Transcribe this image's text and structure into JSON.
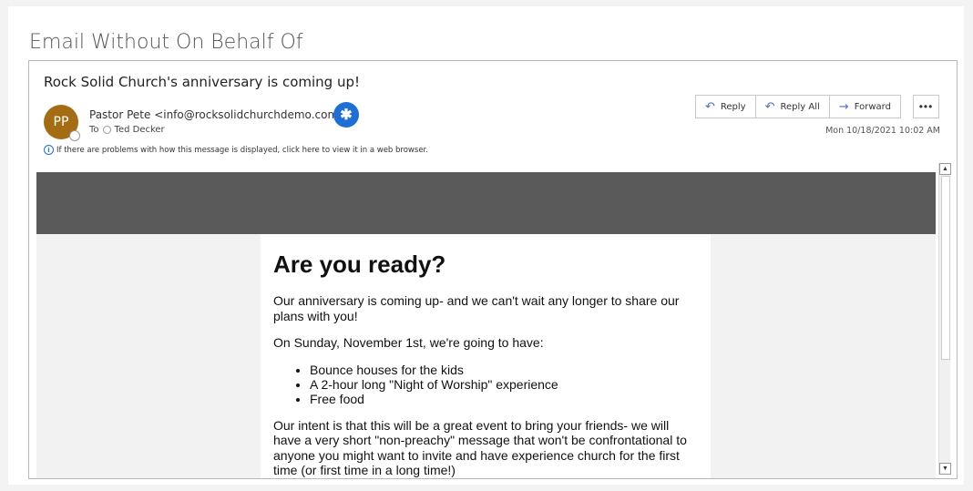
{
  "page": {
    "heading": "Email Without On Behalf Of"
  },
  "email": {
    "subject": "Rock Solid Church's anniversary is coming up!",
    "avatar_initials": "PP",
    "sender": "Pastor Pete <info@rocksolidchurchdemo.com>",
    "to_label": "To",
    "to_name": "Ted Decker",
    "infobar": "If there are problems with how this message is displayed, click here to view it in a web browser.",
    "date": "Mon 10/18/2021 10:02 AM",
    "actions": {
      "reply": "Reply",
      "reply_all": "Reply All",
      "forward": "Forward"
    },
    "badge_icon": "asterisk-icon",
    "accent": "#1d6fd6",
    "avatar_color": "#a46d13"
  },
  "message": {
    "heading": "Are you ready?",
    "para1": "Our anniversary is coming up- and we can't wait any longer to share our plans with you!",
    "para2": "On Sunday, November 1st, we're going to have:",
    "bullets": [
      "Bounce houses for the kids",
      "A 2-hour long \"Night of Worship\" experience",
      "Free food"
    ],
    "para3": "Our intent is that this will be a great event to bring your friends- we will have a very short \"non-preachy\" message that won't be confrontational to anyone you might want to invite and have experience church for the first time (or first time in a long time!)"
  }
}
